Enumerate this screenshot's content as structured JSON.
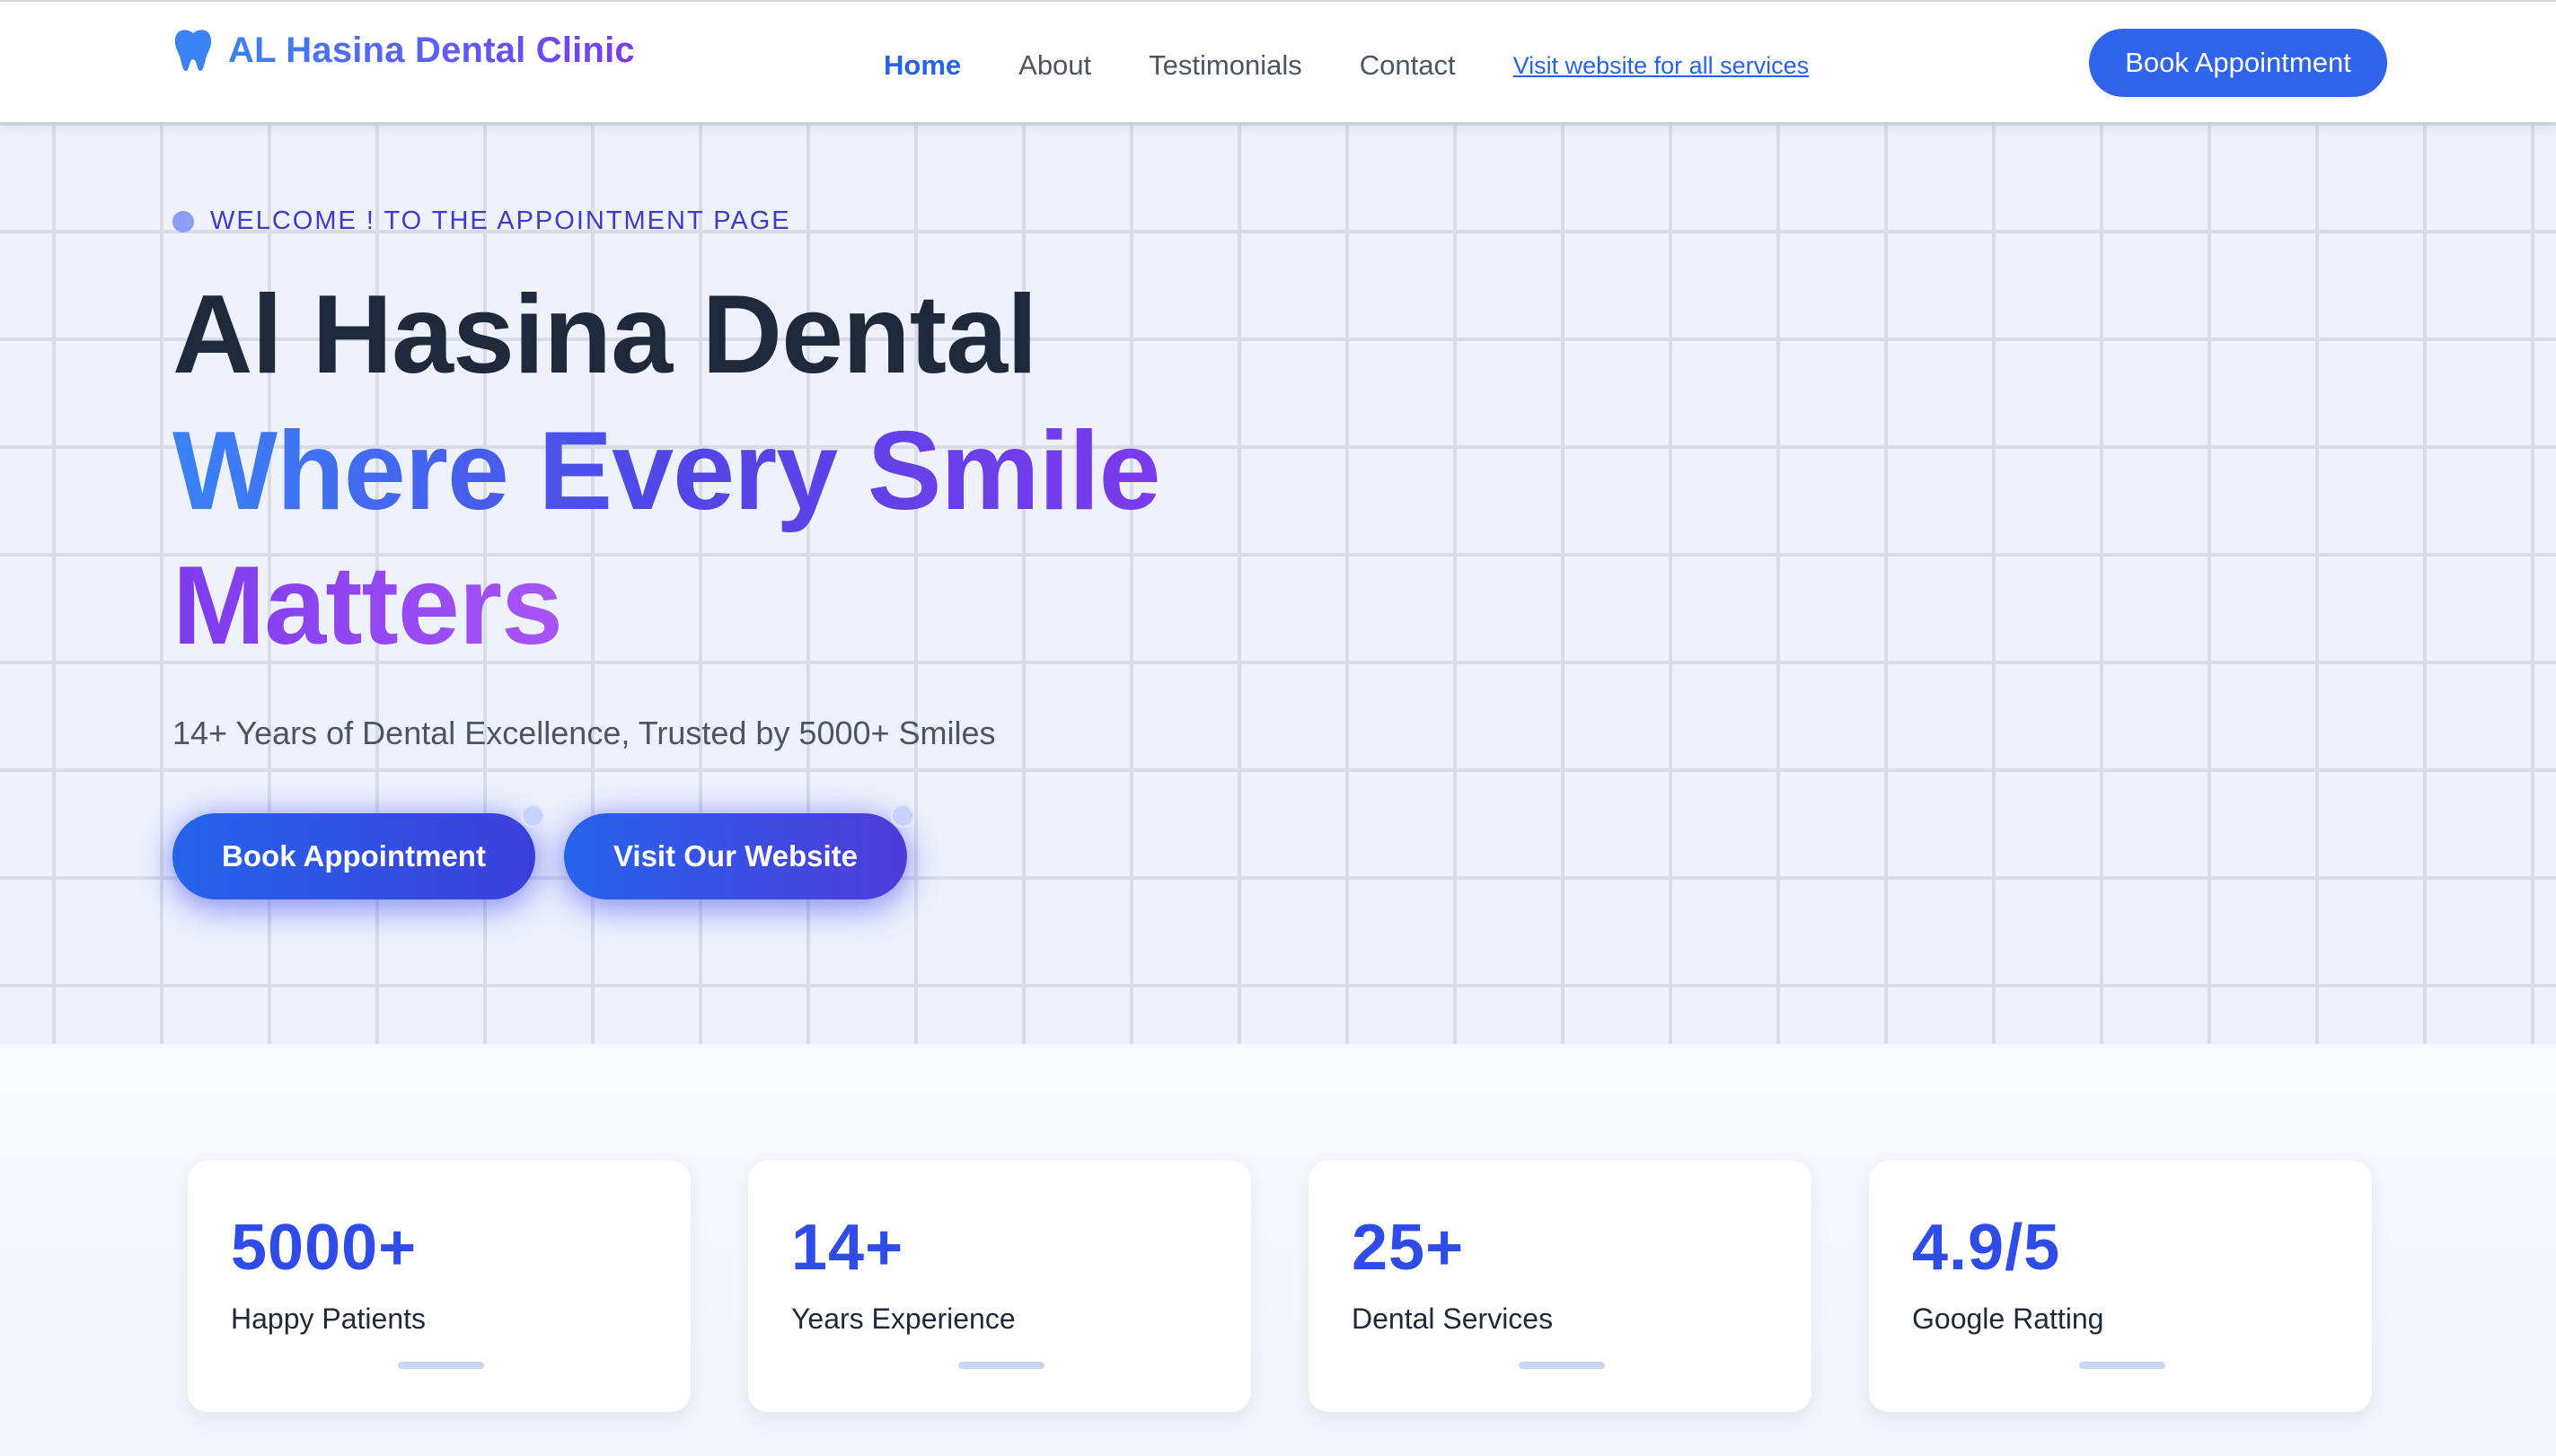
{
  "navbar": {
    "brand": "AL Hasina Dental Clinic",
    "brand_icon": "tooth-icon",
    "links": [
      "Home",
      "About",
      "Testimonials",
      "Contact"
    ],
    "services_link": "Visit website for all services",
    "cta": "Book Appointment"
  },
  "hero": {
    "eyebrow": "WELCOME ! TO THE APPOINTMENT PAGE",
    "title_line1": "Al Hasina Dental",
    "title_line2": "Where Every Smile",
    "title_line3": "Matters",
    "subtitle": "14+ Years of Dental Excellence, Trusted by 5000+ Smiles",
    "primary_button": "Book Appointment",
    "secondary_button": "Visit Our Website"
  },
  "stats": [
    {
      "value": "5000+",
      "label": "Happy Patients"
    },
    {
      "value": "14+",
      "label": "Years Experience"
    },
    {
      "value": "25+",
      "label": "Dental Services"
    },
    {
      "value": "4.9/5",
      "label": "Google Ratting"
    }
  ],
  "colors": {
    "primary": "#2563eb",
    "accent_purple": "#7c3aed",
    "heading_dark": "#1e293b",
    "stat_value": "#2f4be8"
  }
}
